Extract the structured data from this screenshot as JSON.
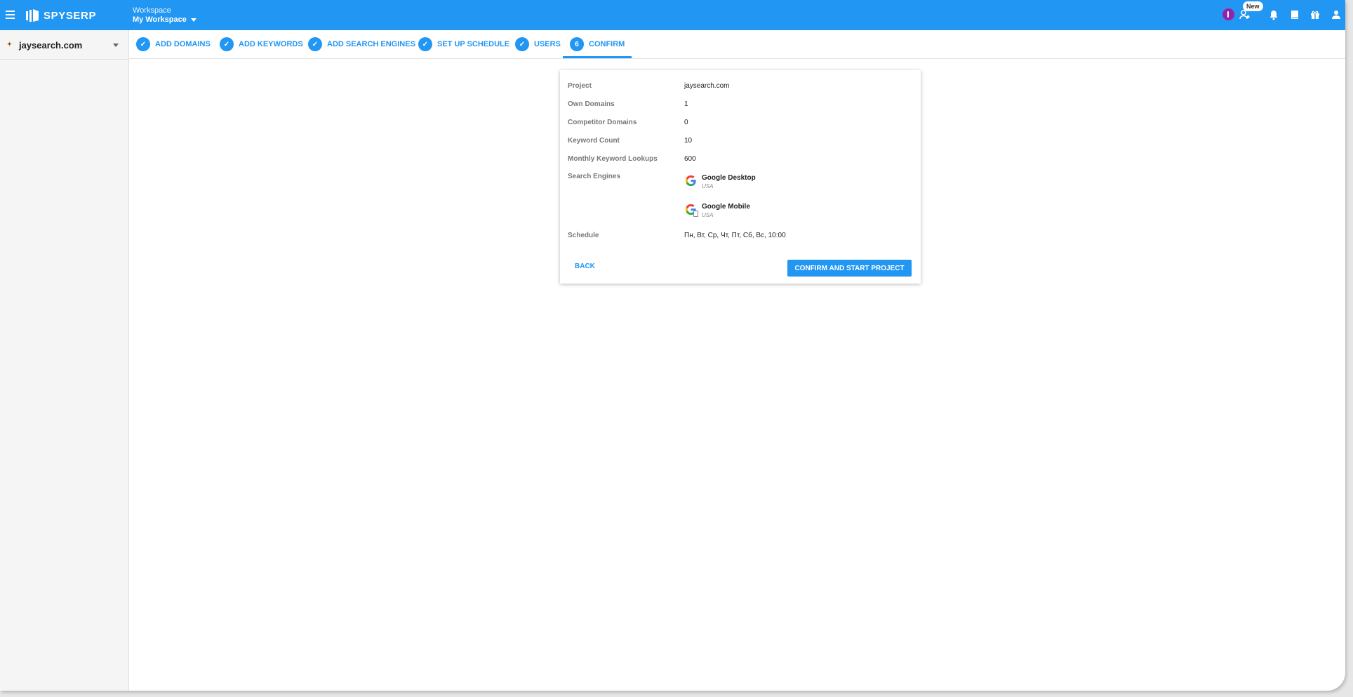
{
  "app": {
    "logo_text": "SPYSERP",
    "workspace_label": "Workspace",
    "workspace_name": "My Workspace",
    "new_badge": "New",
    "accent_color": "#2196f3"
  },
  "top_icons": [
    "menu-icon",
    "account-circle-icon",
    "user-settings-icon",
    "bell-icon",
    "book-icon",
    "gift-icon",
    "user-icon"
  ],
  "sidebar": {
    "project_name": "jaysearch.com"
  },
  "stepper": {
    "steps": [
      {
        "label": "ADD DOMAINS",
        "marker": "✓",
        "state": "done"
      },
      {
        "label": "ADD KEYWORDS",
        "marker": "✓",
        "state": "done"
      },
      {
        "label": "ADD SEARCH ENGINES",
        "marker": "✓",
        "state": "done"
      },
      {
        "label": "SET UP SCHEDULE",
        "marker": "✓",
        "state": "done"
      },
      {
        "label": "USERS",
        "marker": "✓",
        "state": "done"
      },
      {
        "label": "CONFIRM",
        "marker": "6",
        "state": "active"
      }
    ]
  },
  "summary": {
    "rows": [
      {
        "label": "Project",
        "value": "jaysearch.com"
      },
      {
        "label": "Own Domains",
        "value": "1"
      },
      {
        "label": "Competitor Domains",
        "value": "0"
      },
      {
        "label": "Keyword Count",
        "value": "10"
      },
      {
        "label": "Monthly Keyword Lookups",
        "value": "600"
      },
      {
        "label": "Search Engines",
        "value": ""
      },
      {
        "label": "Schedule",
        "value": "Пн, Вт, Ср, Чт, Пт, Сб, Вс, 10:00"
      }
    ],
    "engines": [
      {
        "name": "Google Desktop",
        "country": "USA",
        "icon": "google-icon"
      },
      {
        "name": "Google Mobile",
        "country": "USA",
        "icon": "google-mobile-icon"
      }
    ],
    "back_label": "BACK",
    "confirm_label": "CONFIRM AND START PROJECT"
  }
}
